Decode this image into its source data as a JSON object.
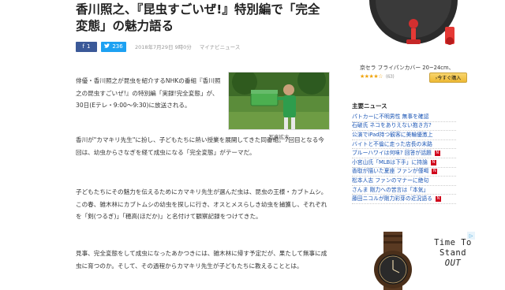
{
  "article": {
    "title": "香川照之、『昆虫すごいぜ!』特別編で「完全変態」の魅力語る",
    "share": {
      "facebook_count": "1",
      "twitter_count": "236"
    },
    "date": "2018年7月29日 9時0分",
    "source": "マイナビニュース",
    "paragraphs": [
      "俳優・香川照之が昆虫を紹介するNHKの番組『香川照之の昆虫すごいぜ!』の特別編「実録!完全変態」が、30日(Eテレ・9:00〜9:30)に放送される。",
      "香川が\"カマキリ先生\"に扮し、子どもたちに熱い授業を展開してきた同番組。7回目となる今回は、幼虫からさなぎを経て成虫になる「完全変態」がテーマだ。",
      "子どもたちにその魅力を伝えるためにカマキリ先生が選んだ虫は、昆虫の王様・カブトムシ。この春、雑木林にカブトムシの幼虫を探しに行き、オスとメスらしき幼虫を捕獲し、それぞれを「剣(つるぎ)」「穂高(ほだか)」と名付けて観察記録をつけてきた。",
      "見事、完全変態をして成虫になったあかつきには、雑木林に帰す予定だが、果たして無事に成虫に育つのか。そして、その過程からカマキリ先生が子どもたちに教えることとは。"
    ],
    "photo_caption": "写真拡大"
  },
  "sidebar": {
    "ad_top": {
      "product_text": "京セラ フライパンカバー 20~24cm、",
      "stars": "★★★★☆",
      "review_count": "(63)",
      "buy_label": "›今すぐ購入"
    },
    "news_heading": "主要ニュース",
    "news": [
      {
        "text": "パトカーに不明男性 無事を確認",
        "badge": ""
      },
      {
        "text": "石破氏 ネコをありえない抱き方?",
        "badge": ""
      },
      {
        "text": "公演でiPad持つ観客に美輪優激上",
        "badge": ""
      },
      {
        "text": "バイトと不倫に走った店長の末路",
        "badge": ""
      },
      {
        "text": "ブルーハワイは何味? 回答が話題",
        "badge": "N"
      },
      {
        "text": "小宮山氏「MLBは下手」に持論",
        "badge": "N"
      },
      {
        "text": "香取が描いた夏座 ファンが僅喝",
        "badge": "N"
      },
      {
        "text": "松本人志 ファンのマナーに絶句",
        "badge": ""
      },
      {
        "text": "さんま 剛力への苦言は「本気」",
        "badge": ""
      },
      {
        "text": "藤田ニコルが剛力彩芽の近況語る",
        "badge": "N"
      }
    ],
    "ad_watch": {
      "lines": [
        "Time To",
        "Stand",
        "OUT"
      ]
    }
  }
}
